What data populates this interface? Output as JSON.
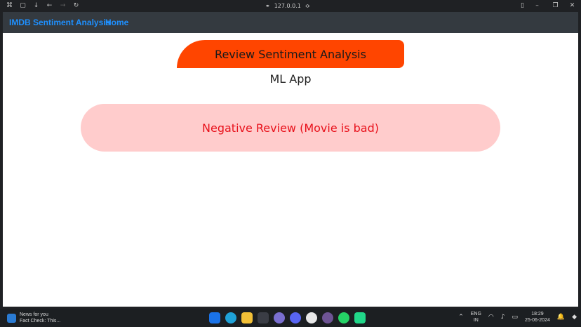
{
  "browser": {
    "url": "127.0.0.1"
  },
  "navbar": {
    "brand": "IMDB Sentiment Analysis",
    "home": "Home"
  },
  "page": {
    "title": "Review Sentiment Analysis",
    "subtitle": "ML App",
    "result": "Negative Review (Movie is bad)"
  },
  "colors": {
    "nav_bg": "#343a40",
    "nav_link": "#1e90ff",
    "title_bg": "#ff4500",
    "result_bg": "#ffcccc",
    "result_text": "#e8101a"
  },
  "taskbar": {
    "news_title": "News for you",
    "news_sub": "Fact Check: This...",
    "lang": "ENG",
    "region": "IN",
    "time": "18:29",
    "date": "25-06-2024"
  }
}
